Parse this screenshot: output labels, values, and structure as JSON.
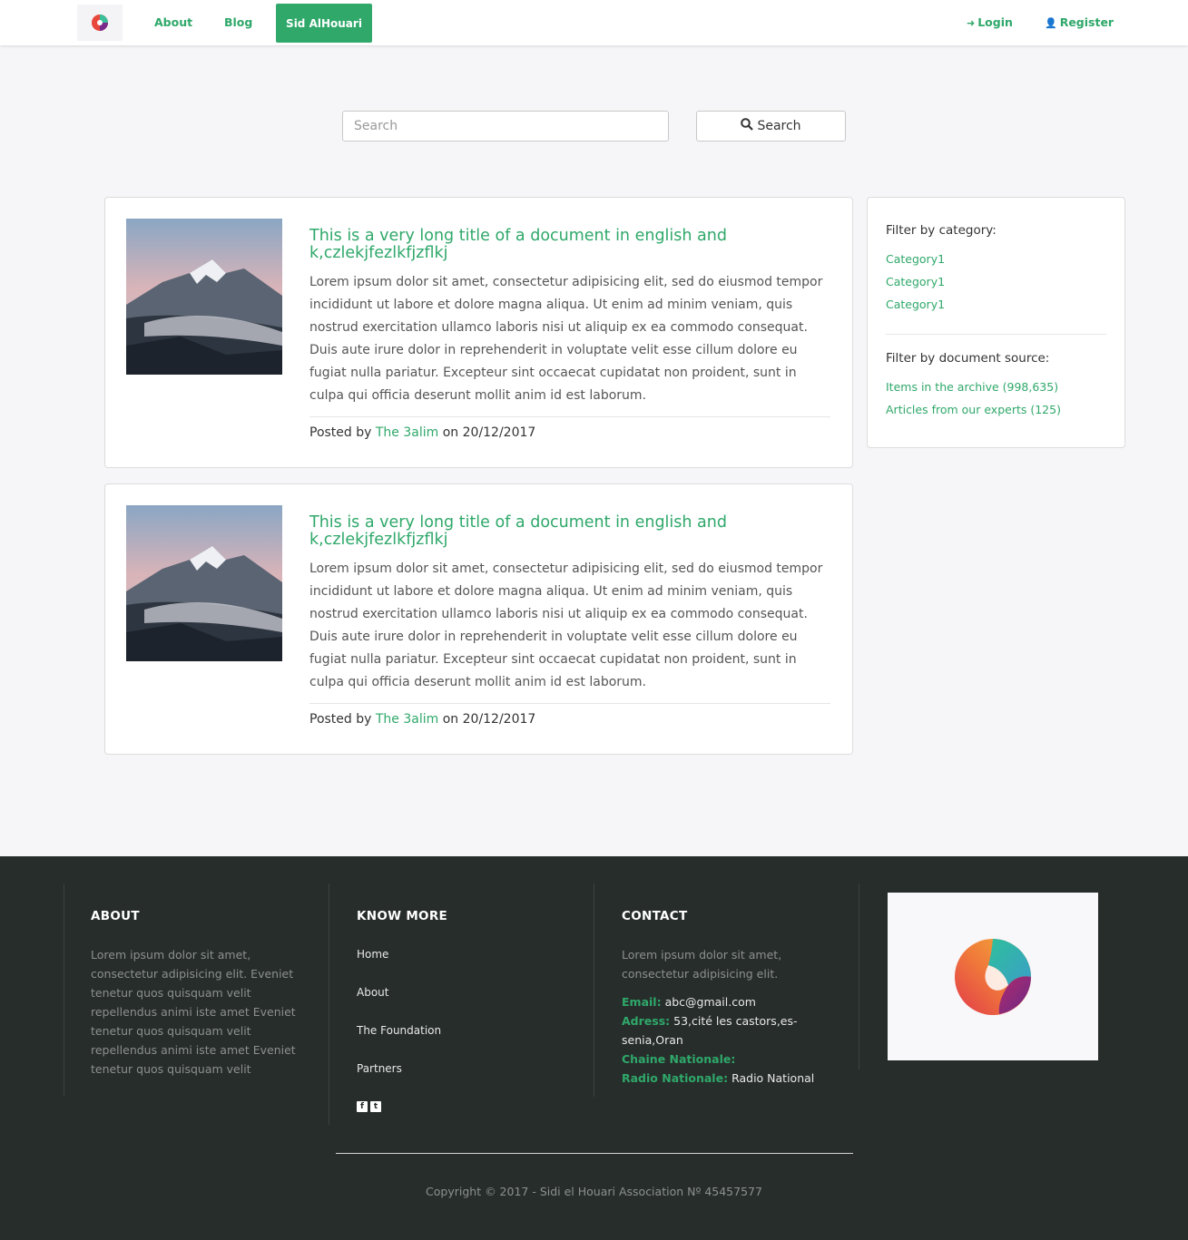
{
  "nav": {
    "about": "About",
    "blog": "Blog",
    "active": "Sid AlHouari",
    "login": "Login",
    "register": "Register"
  },
  "search": {
    "placeholder": "Search",
    "button": "Search"
  },
  "posts": [
    {
      "title": "This is a very long title of a document in english and k,czlekjfezlkfjzflkj",
      "body": "Lorem ipsum dolor sit amet, consectetur adipisicing elit, sed do eiusmod tempor incididunt ut labore et dolore magna aliqua. Ut enim ad minim veniam, quis nostrud exercitation ullamco laboris nisi ut aliquip ex ea commodo consequat. Duis aute irure dolor in reprehenderit in voluptate velit esse cillum dolore eu fugiat nulla pariatur. Excepteur sint occaecat cupidatat non proident, sunt in culpa qui officia deserunt mollit anim id est laborum.",
      "posted_by": "Posted by",
      "author": "The 3alim",
      "on": "on 20/12/2017"
    },
    {
      "title": "This is a very long title of a document in english and k,czlekjfezlkfjzflkj",
      "body": "Lorem ipsum dolor sit amet, consectetur adipisicing elit, sed do eiusmod tempor incididunt ut labore et dolore magna aliqua. Ut enim ad minim veniam, quis nostrud exercitation ullamco laboris nisi ut aliquip ex ea commodo consequat. Duis aute irure dolor in reprehenderit in voluptate velit esse cillum dolore eu fugiat nulla pariatur. Excepteur sint occaecat cupidatat non proident, sunt in culpa qui officia deserunt mollit anim id est laborum.",
      "posted_by": "Posted by",
      "author": "The 3alim",
      "on": "on 20/12/2017"
    }
  ],
  "sidebar": {
    "category_heading": "Filter by category:",
    "categories": [
      "Category1",
      "Category1",
      "Category1"
    ],
    "source_heading": "Filter by document source:",
    "sources": [
      "Items in the archive (998,635)",
      "Articles from our experts (125)"
    ]
  },
  "footer": {
    "about_heading": "ABOUT",
    "about_text": "Lorem ipsum dolor sit amet, consectetur adipisicing elit. Eveniet tenetur quos quisquam velit repellendus animi iste amet Eveniet tenetur quos quisquam velit repellendus animi iste amet Eveniet tenetur quos quisquam velit",
    "know_heading": "KNOW MORE",
    "know_links": [
      "Home",
      "About",
      "The Foundation",
      "Partners"
    ],
    "contact_heading": "CONTACT",
    "contact_text": "Lorem ipsum dolor sit amet, consectetur adipisicing elit.",
    "email_label": "Email:",
    "email": "abc@gmail.com",
    "address_label": "Adress:",
    "address_line1": "53,cité les castors,es-",
    "address_line2": "senia,Oran",
    "chaine_label": "Chaine Nationale:",
    "radio_label": "Radio Nationale:",
    "radio": "Radio National",
    "copyright": "Copyright © 2017 - Sidi el Houari Association Nº 45457577"
  },
  "colors": {
    "accent": "#2fa86a",
    "footer_bg": "#272d2b",
    "page_bg": "#f6f5f7"
  },
  "icons": {
    "login": "sign-in-icon",
    "register": "user-plus-icon",
    "search": "search-icon",
    "facebook": "facebook-icon",
    "twitter": "twitter-icon"
  }
}
